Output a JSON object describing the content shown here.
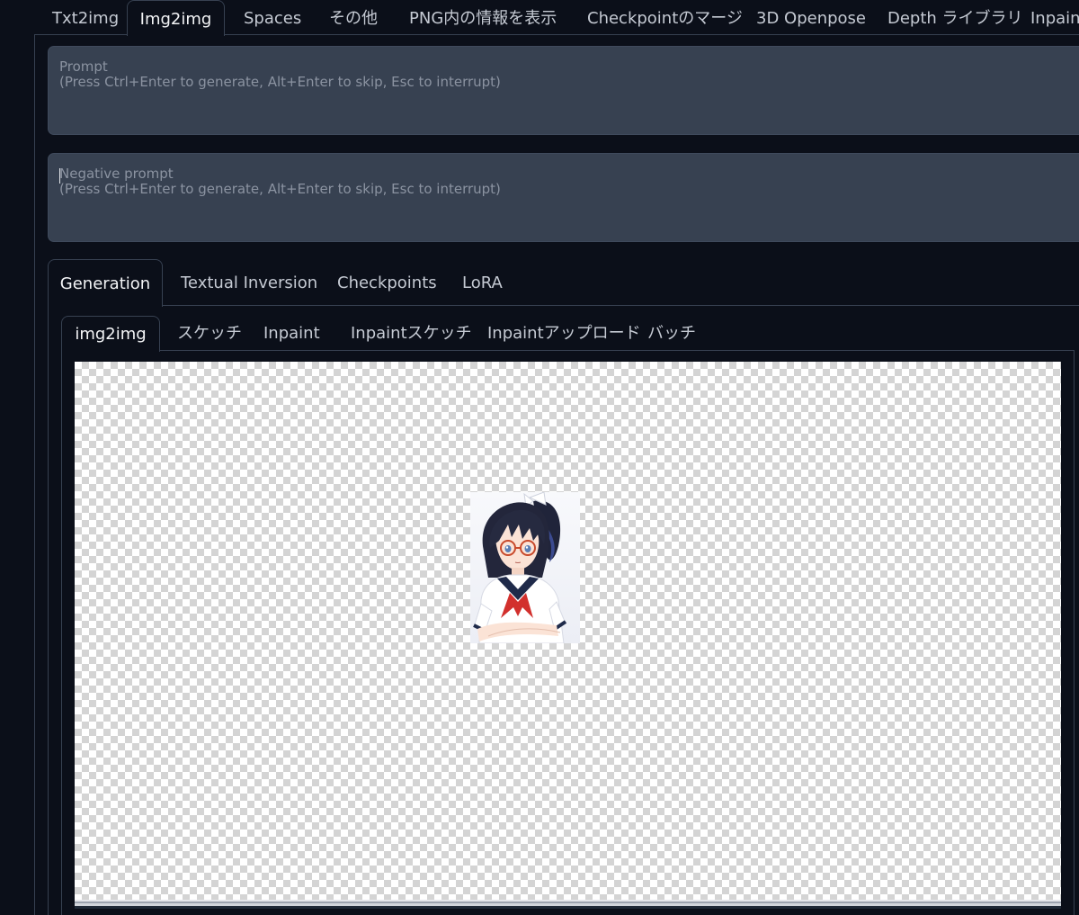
{
  "top_tabs": [
    {
      "label": "Txt2img"
    },
    {
      "label": "Img2img"
    },
    {
      "label": "Spaces"
    },
    {
      "label": "その他"
    },
    {
      "label": "PNG内の情報を表示"
    },
    {
      "label": "Checkpointのマージ"
    },
    {
      "label": "3D Openpose"
    },
    {
      "label": "Depth ライブラリ"
    },
    {
      "label": "Inpaint"
    }
  ],
  "active_top_tab": "Img2img",
  "prompt": {
    "placeholder_line1": "Prompt",
    "placeholder_line2": "(Press Ctrl+Enter to generate, Alt+Enter to skip, Esc to interrupt)"
  },
  "negative_prompt": {
    "placeholder_line1": "Negative prompt",
    "placeholder_line2": "(Press Ctrl+Enter to generate, Alt+Enter to skip, Esc to interrupt)"
  },
  "gen_tabs": [
    {
      "label": "Generation"
    },
    {
      "label": "Textual Inversion"
    },
    {
      "label": "Checkpoints"
    },
    {
      "label": "LoRA"
    }
  ],
  "active_gen_tab": "Generation",
  "sub_tabs": [
    {
      "label": "img2img"
    },
    {
      "label": "スケッチ"
    },
    {
      "label": "Inpaint"
    },
    {
      "label": "Inpaintスケッチ"
    },
    {
      "label": "Inpaintアップロード"
    },
    {
      "label": "バッチ"
    }
  ],
  "active_sub_tab": "img2img",
  "colors": {
    "background": "#0b0f19",
    "input_bg": "#374151",
    "border": "#374151"
  }
}
